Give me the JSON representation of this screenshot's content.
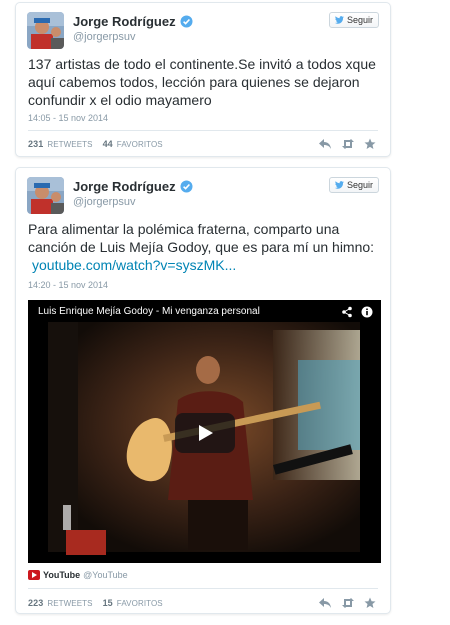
{
  "tweets": [
    {
      "author_name": "Jorge Rodríguez",
      "handle": "@jorgerpsuv",
      "follow_label": "Seguir",
      "text": "137 artistas de todo el continente.Se invitó a todos xque aquí cabemos todos, lección para quienes se dejaron confundir x el odio mayamero",
      "time": "14:05 - 15 nov 2014",
      "retweets_count": "231",
      "retweets_label": "RETWEETS",
      "favorites_count": "44",
      "favorites_label": "FAVORITOS"
    },
    {
      "author_name": "Jorge Rodríguez",
      "handle": "@jorgerpsuv",
      "follow_label": "Seguir",
      "text": "Para alimentar la polémica fraterna, comparto una canción de Luis Mejía Godoy, que es para mí un himno:",
      "link": "youtube.com/watch?v=syszMK...",
      "time": "14:20 - 15 nov 2014",
      "video_title": "Luis Enrique Mejía Godoy - Mi venganza personal",
      "source_name": "YouTube",
      "source_handle": "@YouTube",
      "retweets_count": "223",
      "retweets_label": "RETWEETS",
      "favorites_count": "15",
      "favorites_label": "FAVORITOS"
    }
  ],
  "icons": {
    "verified": "verified-badge-icon",
    "follow_bird": "twitter-bird-icon",
    "reply": "reply-icon",
    "retweet": "retweet-icon",
    "favorite": "star-icon",
    "share": "share-icon",
    "info": "info-icon",
    "play": "play-icon",
    "youtube": "youtube-icon"
  },
  "colors": {
    "link": "#0084b4",
    "verified": "#55acee",
    "meta": "#8899a6",
    "text": "#292f33"
  }
}
